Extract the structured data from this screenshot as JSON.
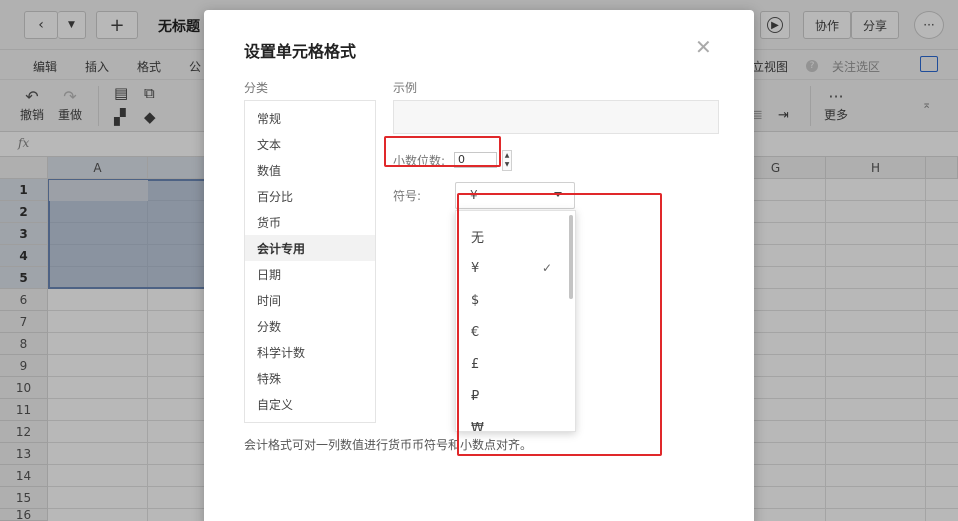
{
  "topbar": {
    "back_icon": "chevron-left",
    "dropdown_icon": "caret-down",
    "new_icon": "plus",
    "doc_title": "无标题",
    "collaborate": "协作",
    "share": "分享",
    "more_icon": "ellipsis"
  },
  "menubar": {
    "items": [
      "编辑",
      "插入",
      "格式",
      "公"
    ],
    "right": {
      "view": "立视图",
      "help": "?",
      "follow": "关注选区"
    }
  },
  "toolbar": {
    "undo": "撤销",
    "redo": "重做",
    "more": "更多"
  },
  "sheet": {
    "fx": "fx",
    "columns": [
      "A",
      "G",
      "H"
    ],
    "rows": [
      "1",
      "2",
      "3",
      "4",
      "5",
      "6",
      "7",
      "8",
      "9",
      "10",
      "11",
      "12",
      "13",
      "14",
      "15",
      "16"
    ]
  },
  "dialog": {
    "title": "设置单元格格式",
    "category_label": "分类",
    "categories": [
      "常规",
      "文本",
      "数值",
      "百分比",
      "货币",
      "会计专用",
      "日期",
      "时间",
      "分数",
      "科学计数",
      "特殊",
      "自定义"
    ],
    "active_category": "会计专用",
    "preview_label": "示例",
    "decimal_label": "小数位数:",
    "decimal_value": "0",
    "symbol_label": "符号:",
    "symbol_value": "¥",
    "symbol_options": [
      "无",
      "¥",
      "$",
      "€",
      "£",
      "₽",
      "₩"
    ],
    "selected_symbol": "¥",
    "description": "会计格式可对一列数值进行货币币符号和小数点对齐。"
  },
  "colors": {
    "highlight_red": "#e0282a",
    "selection_fill": "#96aac8",
    "selection_border": "#6b88b8"
  }
}
